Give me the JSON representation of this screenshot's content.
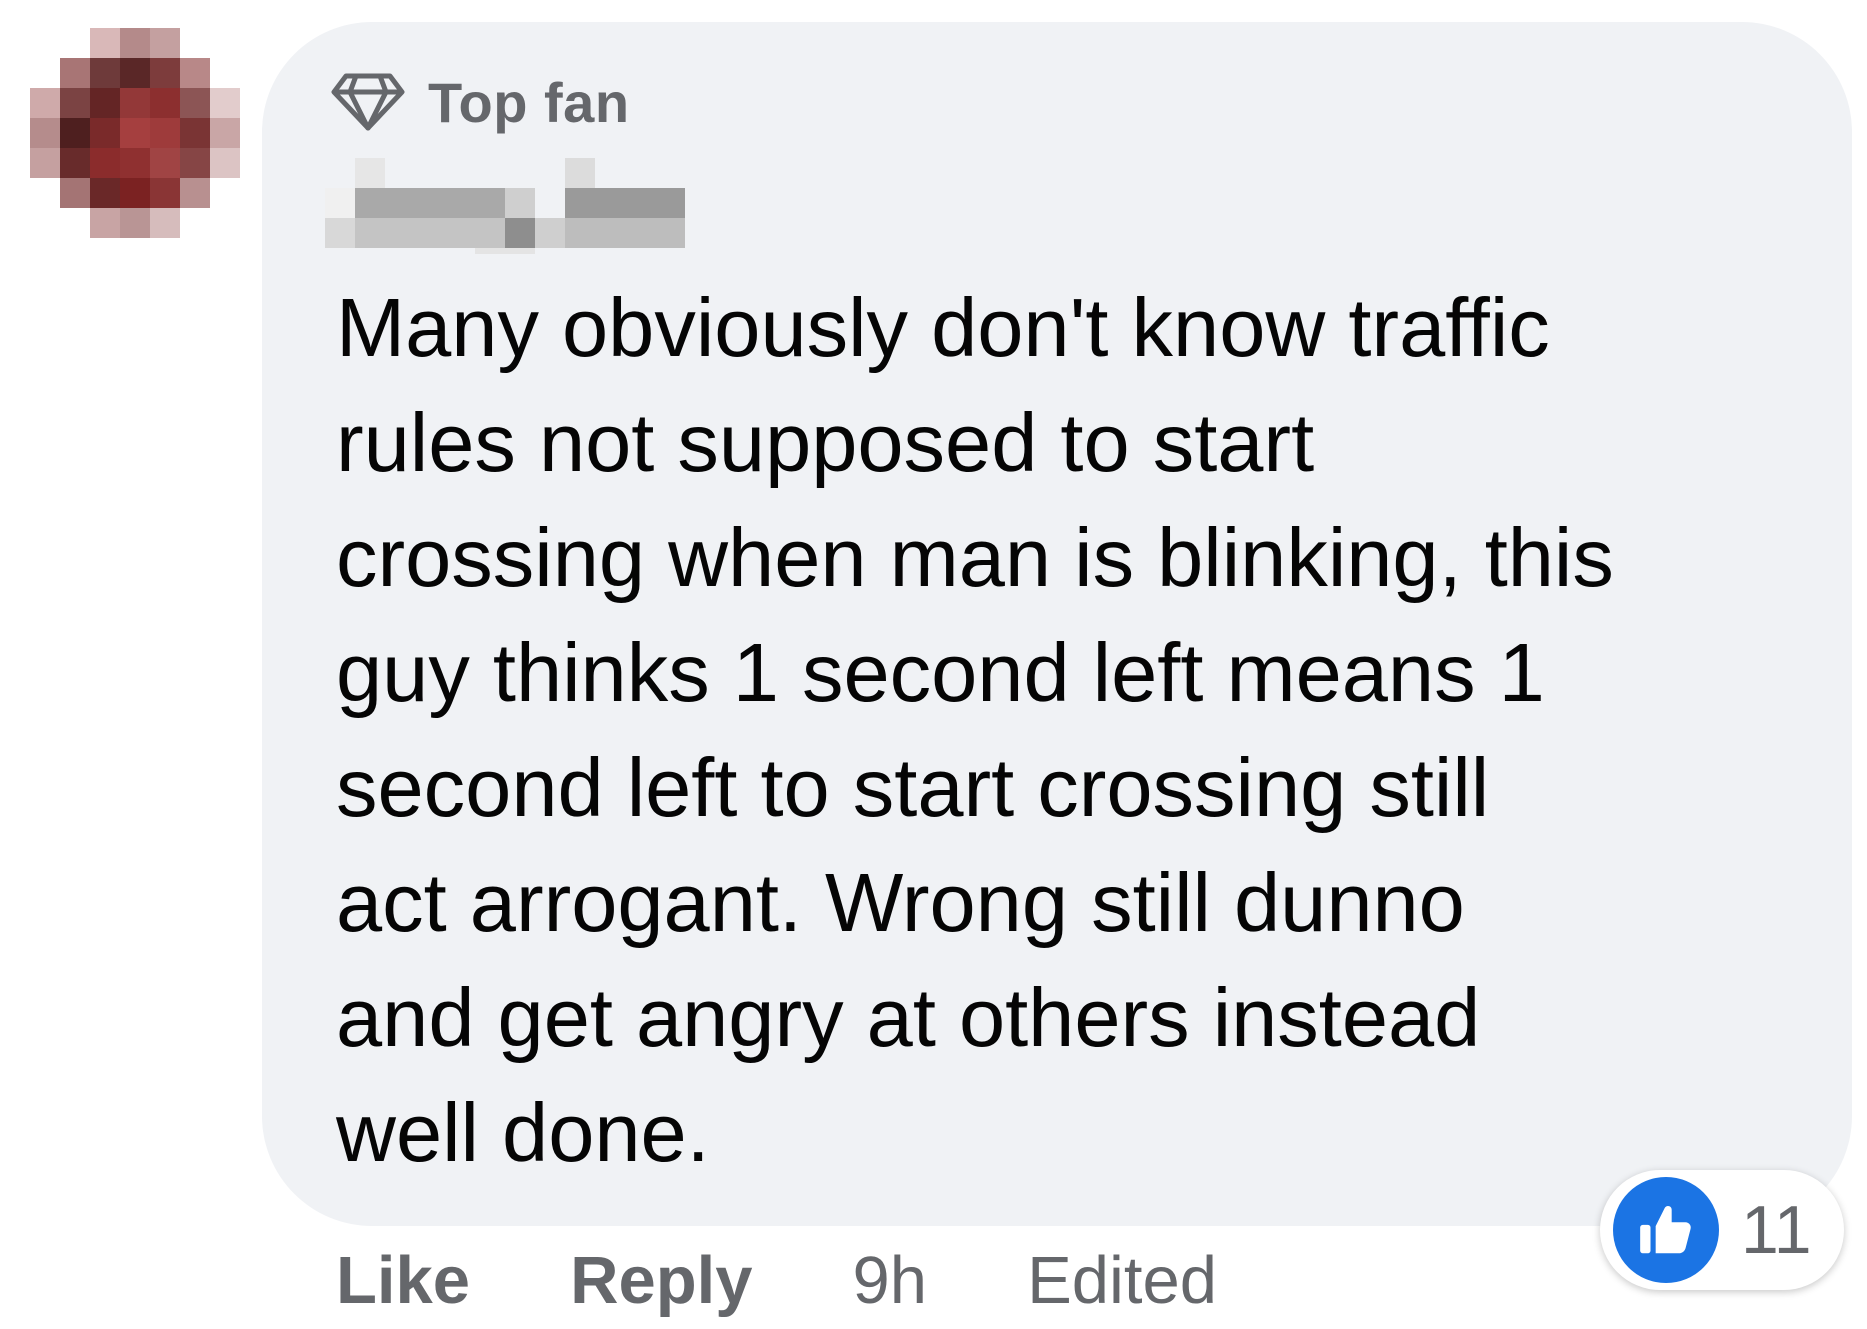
{
  "comment": {
    "badge": {
      "icon": "diamond-icon",
      "label": "Top fan"
    },
    "text": "Many obviously don't know traffic\nrules not supposed to start\ncrossing when man is blinking, this\nguy thinks 1 second left means 1\nsecond left to start crossing still\nact arrogant. Wrong still dunno\nand get angry at others instead\nwell done.",
    "actions": {
      "like_label": "Like",
      "reply_label": "Reply",
      "time": "9h",
      "edited_label": "Edited"
    },
    "reactions": {
      "icon": "thumbs-up-icon",
      "count": "11",
      "color": "#1b74e4"
    }
  },
  "colors": {
    "bubble_background": "#f0f2f5",
    "text": "#050505",
    "secondary_text": "#65676b"
  }
}
